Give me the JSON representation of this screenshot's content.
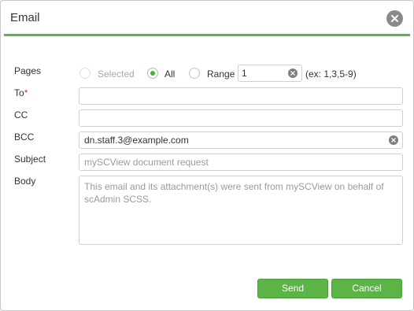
{
  "dialog": {
    "title": "Email"
  },
  "labels": {
    "pages": "Pages",
    "to": "To",
    "to_required": "*",
    "cc": "CC",
    "bcc": "BCC",
    "subject": "Subject",
    "body": "Body"
  },
  "pages": {
    "options": [
      {
        "label": "Selected",
        "state": "disabled"
      },
      {
        "label": "All",
        "state": "checked"
      },
      {
        "label": "Range",
        "state": "unchecked"
      }
    ],
    "range_value": "1",
    "range_hint": "(ex: 1,3,5-9)"
  },
  "fields": {
    "to_value": "",
    "cc_value": "",
    "bcc_value": "dn.staff.3@example.com",
    "subject_placeholder": "mySCView document request",
    "body_placeholder": "This email and its attachment(s) were sent from mySCView on behalf of scAdmin SCSS."
  },
  "buttons": {
    "send": "Send",
    "cancel": "Cancel"
  },
  "colors": {
    "accent": "#5cb346",
    "required": "#d9342b"
  }
}
